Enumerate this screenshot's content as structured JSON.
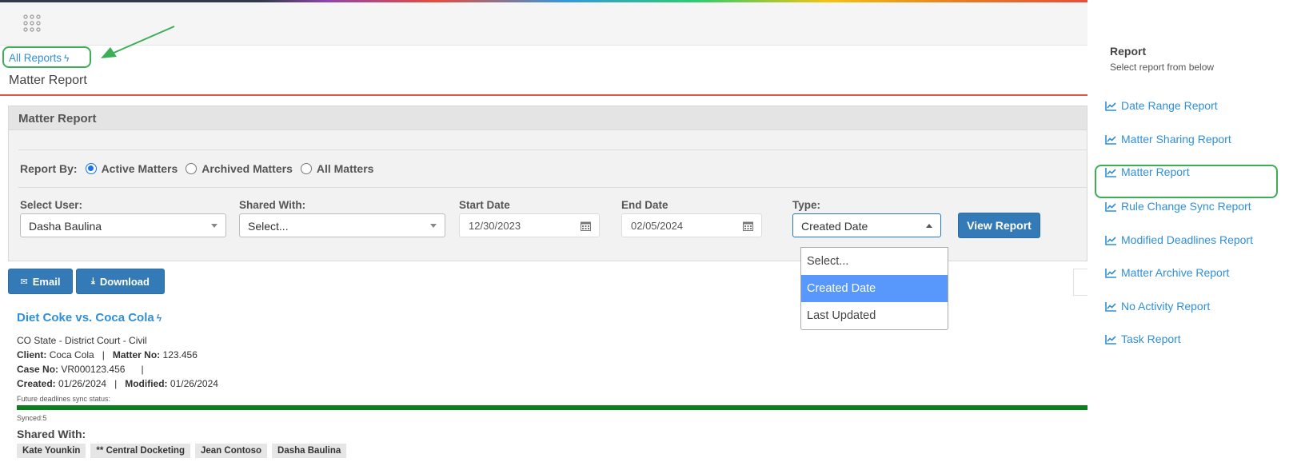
{
  "breadcrumb": {
    "label": "All Reports",
    "icon": "bolt-icon"
  },
  "page_title": "Matter Report",
  "panel": {
    "title": "Matter Report",
    "report_by_label": "Report By:",
    "report_by_options": [
      "Active Matters",
      "Archived Matters",
      "All Matters"
    ],
    "report_by_selected": "Active Matters",
    "select_user": {
      "label": "Select User:",
      "value": "Dasha Baulina"
    },
    "shared_with": {
      "label": "Shared With:",
      "value": "Select..."
    },
    "start_date": {
      "label": "Start Date",
      "value": "12/30/2023"
    },
    "end_date": {
      "label": "End Date",
      "value": "02/05/2024"
    },
    "type": {
      "label": "Type:",
      "value": "Created Date",
      "options": [
        "Select...",
        "Created Date",
        "Last Updated"
      ]
    },
    "view_report_label": "View Report"
  },
  "actions": {
    "email_label": "Email",
    "download_label": "Download"
  },
  "result": {
    "title": "Diet Coke vs. Coca Cola",
    "court": "CO State - District Court - Civil",
    "client_label": "Client:",
    "client": "Coca Cola",
    "matter_no_label": "Matter No:",
    "matter_no": "123.456",
    "case_no_label": "Case No:",
    "case_no": "VR000123.456",
    "created_label": "Created:",
    "created": "01/26/2024",
    "modified_label": "Modified:",
    "modified": "01/26/2024",
    "sync_status_label": "Future deadlines sync status:",
    "sync_progress": 1.0,
    "synced_text": "Synced:5",
    "shared_with_title": "Shared With:",
    "shared_with": [
      "Kate Younkin",
      "** Central Docketing",
      "Jean Contoso",
      "Dasha Baulina"
    ]
  },
  "sidebar": {
    "title": "Report",
    "subtitle": "Select report from below",
    "items": [
      {
        "label": "Date Range Report"
      },
      {
        "label": "Matter Sharing Report"
      },
      {
        "label": "Matter Report"
      },
      {
        "label": "Rule Change Sync Report"
      },
      {
        "label": "Modified Deadlines Report"
      },
      {
        "label": "Matter Archive Report"
      },
      {
        "label": "No Activity Report"
      },
      {
        "label": "Task Report"
      }
    ],
    "highlighted": "Matter Report"
  },
  "colors": {
    "link": "#2f8fd8",
    "primary_button": "#337ab7",
    "highlight_outline": "#3cae55",
    "sync_bar": "#0a7f1c",
    "rule": "#e05345"
  }
}
